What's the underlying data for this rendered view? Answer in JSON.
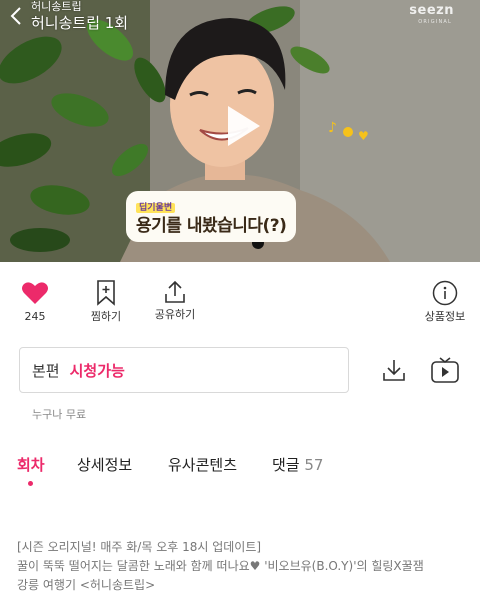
{
  "video": {
    "title_small": "허니송트립",
    "title_big": "허니송트립 1회",
    "brand": "seezn",
    "brand_sub": "ORIGINAL",
    "caption_tag": "딥기울변",
    "caption_text": "용기를 내봤습니다(?)"
  },
  "actions": {
    "like_count": "245",
    "bookmark_label": "찜하기",
    "share_label": "공유하기",
    "info_label": "상품정보"
  },
  "episode": {
    "label": "본편",
    "status": "시청가능"
  },
  "note": "누구나 무료",
  "tabs": {
    "episodes": "회차",
    "details": "상세정보",
    "similar": "유사콘텐츠",
    "comments": "댓글",
    "comments_count": "57"
  },
  "description": {
    "line1": "[시즌 오리지널! 매주 화/목 오후 18시 업데이트]",
    "line2": "꿀이 뚝뚝 떨어지는 달콤한 노래와 함께 떠나요♥ '비오브유(B.O.Y)'의 힐링X꿀잼",
    "line3": "강릉 여행기 <허니송트립>"
  },
  "colors": {
    "accent": "#ec2a6a",
    "heart": "#ec2a6a"
  }
}
